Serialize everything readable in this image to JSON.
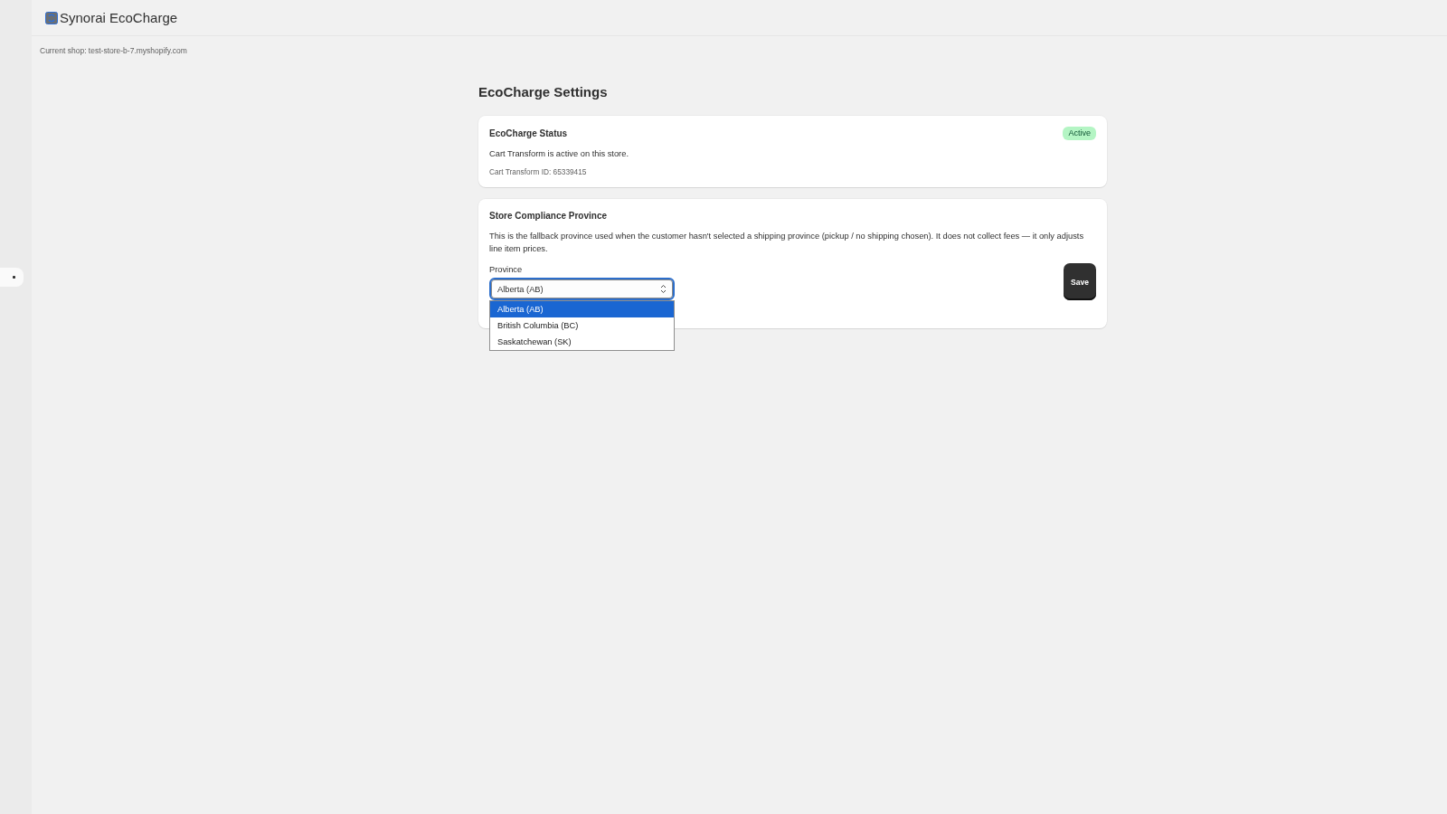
{
  "app_header": {
    "title": "Synorai EcoCharge"
  },
  "current_shop": "Current shop: test-store-b-7.myshopify.com",
  "page_title": "EcoCharge Settings",
  "status_card": {
    "title": "EcoCharge Status",
    "badge": "Active",
    "message": "Cart Transform is active on this store.",
    "transform_id": "Cart Transform ID: 65339415"
  },
  "compliance_card": {
    "title": "Store Compliance Province",
    "description": "This is the fallback province used when the customer hasn't selected a shipping province (pickup / no shipping chosen). It does not collect fees — it only adjusts line item prices.",
    "province_field": {
      "label": "Province",
      "value": "Alberta (AB)",
      "expanded": true,
      "options": [
        {
          "label": "Alberta (AB)",
          "selected": true
        },
        {
          "label": "British Columbia (BC)",
          "selected": false
        },
        {
          "label": "Saskatchewan (SK)",
          "selected": false
        }
      ]
    },
    "save_button": "Save"
  }
}
